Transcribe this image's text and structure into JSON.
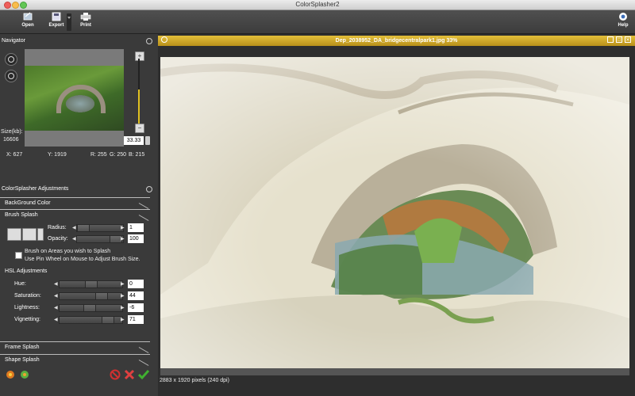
{
  "window": {
    "title": "ColorSplasher2"
  },
  "toolbar": {
    "open_label": "Open",
    "export_label": "Export",
    "print_label": "Print",
    "help_label": "Help"
  },
  "navigator": {
    "title": "Navigator",
    "size_label": "Size(kb):",
    "size_value": "16606",
    "zoom_value": "33.33",
    "x_label": "X: 627",
    "y_label": "Y: 1919",
    "r_label": "R: 255",
    "g_label": "G: 250",
    "b_label": "B: 215"
  },
  "adjustments": {
    "title": "ColorSplasher Adjustments",
    "background_color": "BackGround Color",
    "brush_splash": "Brush Splash",
    "radius_label": "Radius:",
    "radius_value": "1",
    "opacity_label": "Opacity:",
    "opacity_value": "100",
    "brush_hint_1": "Brush on Areas you wish to Splash",
    "brush_hint_2": "Use Pin Wheel on Mouse to Adjust Brush Size.",
    "hsl_title": "HSL Adjustments",
    "hue_label": "Hue:",
    "hue_value": "0",
    "saturation_label": "Saturation:",
    "saturation_value": "44",
    "lightness_label": "Lightness:",
    "lightness_value": "-6",
    "vignetting_label": "Vignetting:",
    "vignetting_value": "71",
    "frame_splash": "Frame Splash",
    "shape_splash": "Shape Splash"
  },
  "image_window": {
    "title": "Dep_2038952_DA_bridgecentralpark1.jpg 33%",
    "status": "2883 x 1920 pixels (240 dpi)"
  },
  "colors": {
    "accent": "#e0c020",
    "panel": "#3a3a3a",
    "toolbar": "#454545",
    "close": "#e04040",
    "ok": "#40b030"
  }
}
